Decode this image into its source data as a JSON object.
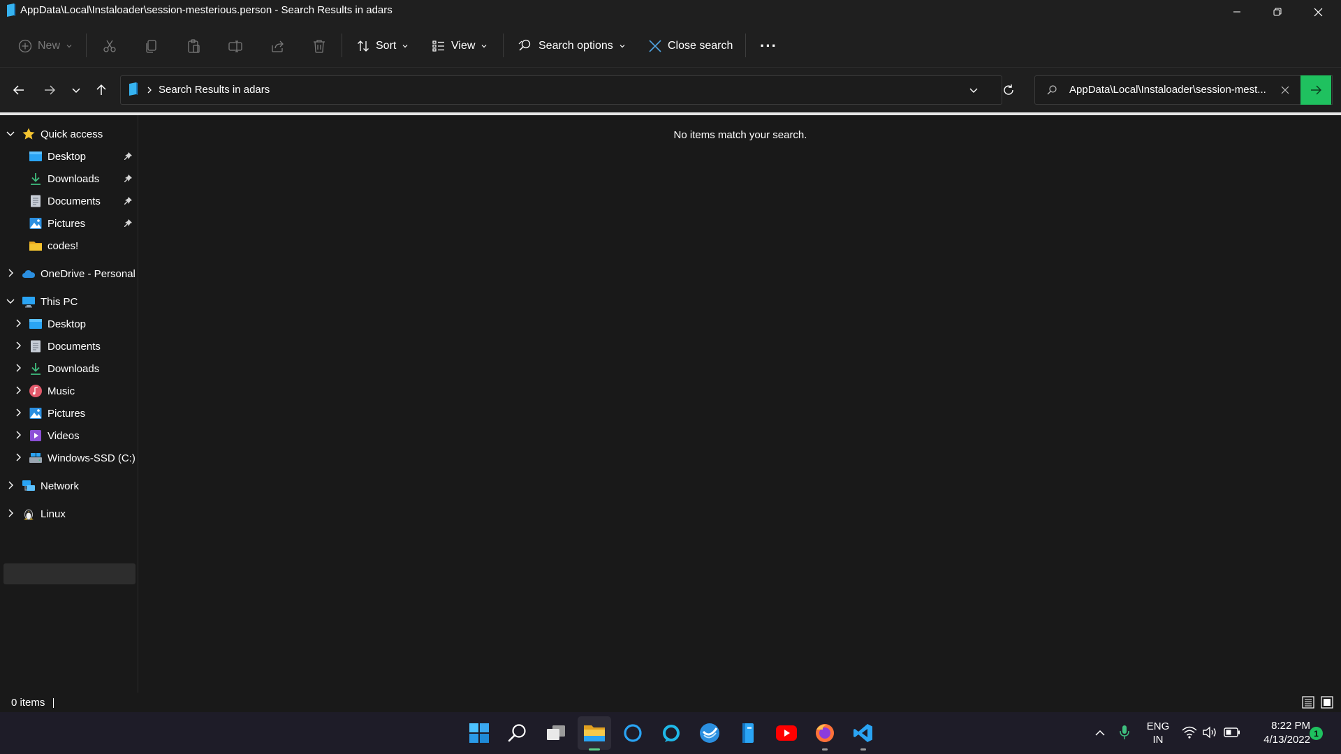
{
  "window": {
    "title": "AppData\\Local\\Instaloader\\session-mesterious.person - Search Results in adars"
  },
  "toolbar": {
    "new_label": "New",
    "sort_label": "Sort",
    "view_label": "View",
    "search_options_label": "Search options",
    "close_search_label": "Close search",
    "more_label": "···"
  },
  "address": {
    "breadcrumb_label": "Search Results in adars"
  },
  "search": {
    "value": "AppData\\Local\\Instaloader\\session-mest..."
  },
  "nav": {
    "quick_access": "Quick access",
    "quick_items": [
      "Desktop",
      "Downloads",
      "Documents",
      "Pictures",
      "codes!"
    ],
    "onedrive": "OneDrive - Personal",
    "this_pc": "This PC",
    "pc_items": [
      "Desktop",
      "Documents",
      "Downloads",
      "Music",
      "Pictures",
      "Videos",
      "Windows-SSD (C:)"
    ],
    "network": "Network",
    "linux": "Linux"
  },
  "content": {
    "empty_message": "No items match your search."
  },
  "status": {
    "item_count": "0 items"
  },
  "taskbar": {
    "language_line1": "ENG",
    "language_line2": "IN",
    "time": "8:22 PM",
    "date": "4/13/2022",
    "notification_count": "1"
  },
  "colors": {
    "accent_green": "#1fc15f",
    "folder_yellow": "#f4c430",
    "windows_blue": "#2aa4f4"
  }
}
